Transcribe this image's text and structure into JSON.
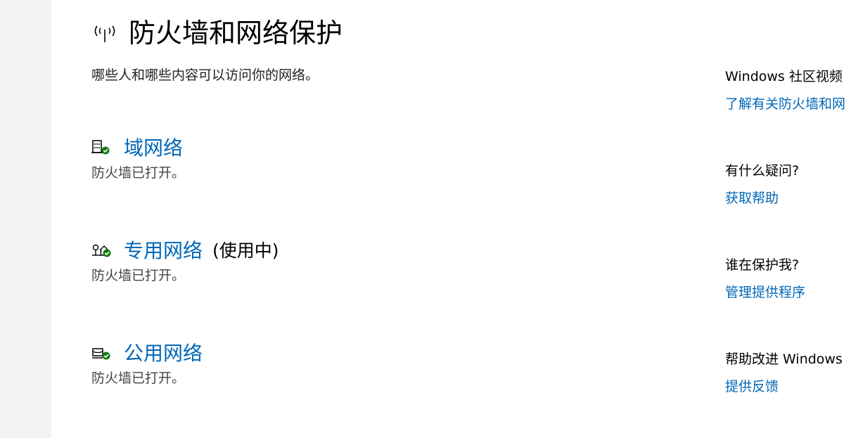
{
  "header": {
    "icon": "antenna-signal-icon",
    "title": "防火墙和网络保护",
    "subtitle": "哪些人和哪些内容可以访问你的网络。"
  },
  "networks": [
    {
      "icon": "domain-building-icon",
      "label": "域网络",
      "suffix": "",
      "status": "防火墙已打开。"
    },
    {
      "icon": "private-home-network-icon",
      "label": "专用网络",
      "suffix": "(使用中)",
      "status": "防火墙已打开。"
    },
    {
      "icon": "public-network-icon",
      "label": "公用网络",
      "suffix": "",
      "status": "防火墙已打开。"
    }
  ],
  "side_panel": {
    "sections": [
      {
        "heading": "Windows 社区视频",
        "link": "了解有关防火墙和网"
      },
      {
        "heading": "有什么疑问?",
        "link": "获取帮助"
      },
      {
        "heading": "谁在保护我?",
        "link": "管理提供程序"
      },
      {
        "heading": "帮助改进 Windows",
        "link": "提供反馈"
      }
    ]
  },
  "colors": {
    "link": "#0067b8",
    "status_ok": "#107c10",
    "left_rail": "#f2f2f2"
  }
}
